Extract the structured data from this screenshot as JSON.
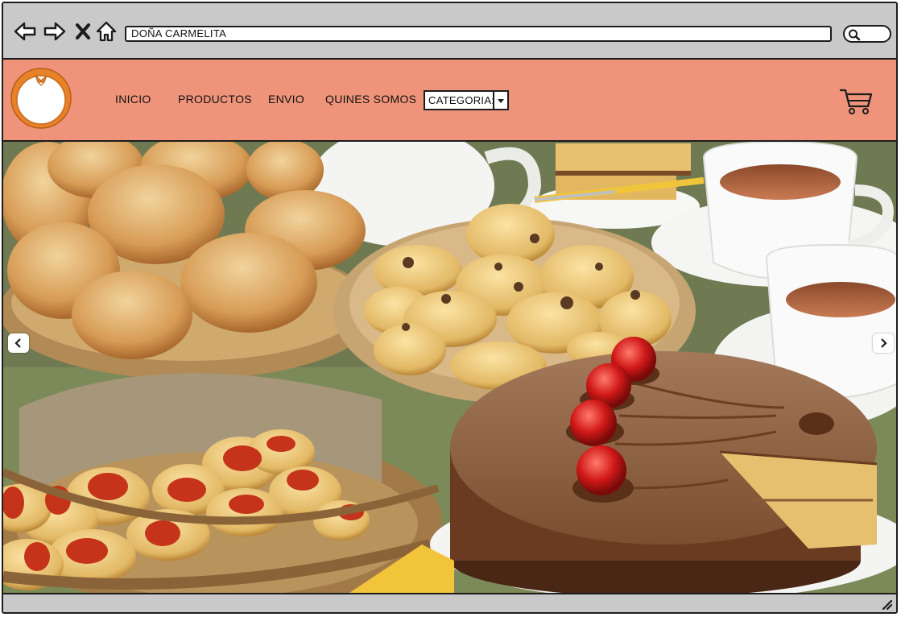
{
  "browser": {
    "address_text": "DOÑA CARMELITA",
    "icons": [
      "back-arrow-icon",
      "forward-arrow-icon",
      "close-icon",
      "home-icon",
      "search-icon"
    ]
  },
  "header": {
    "background_color": "#ef947a",
    "logo_icon": "orange-logo-icon",
    "menu": [
      {
        "label": "INICIO"
      },
      {
        "label": "PRODUCTOS"
      },
      {
        "label": "ENVIO"
      },
      {
        "label": "QUINES SOMOS"
      }
    ],
    "category_select": {
      "value": "CATEGORIA:"
    },
    "cart_icon": "shopping-cart-icon"
  },
  "hero": {
    "image_description_icon": "bakery-food-image",
    "prev_icon": "chevron-left-icon",
    "next_icon": "chevron-right-icon"
  },
  "colors": {
    "chrome": "#c9c9c9",
    "border": "#1c1c1c",
    "logo_orange": "#e8822a"
  }
}
